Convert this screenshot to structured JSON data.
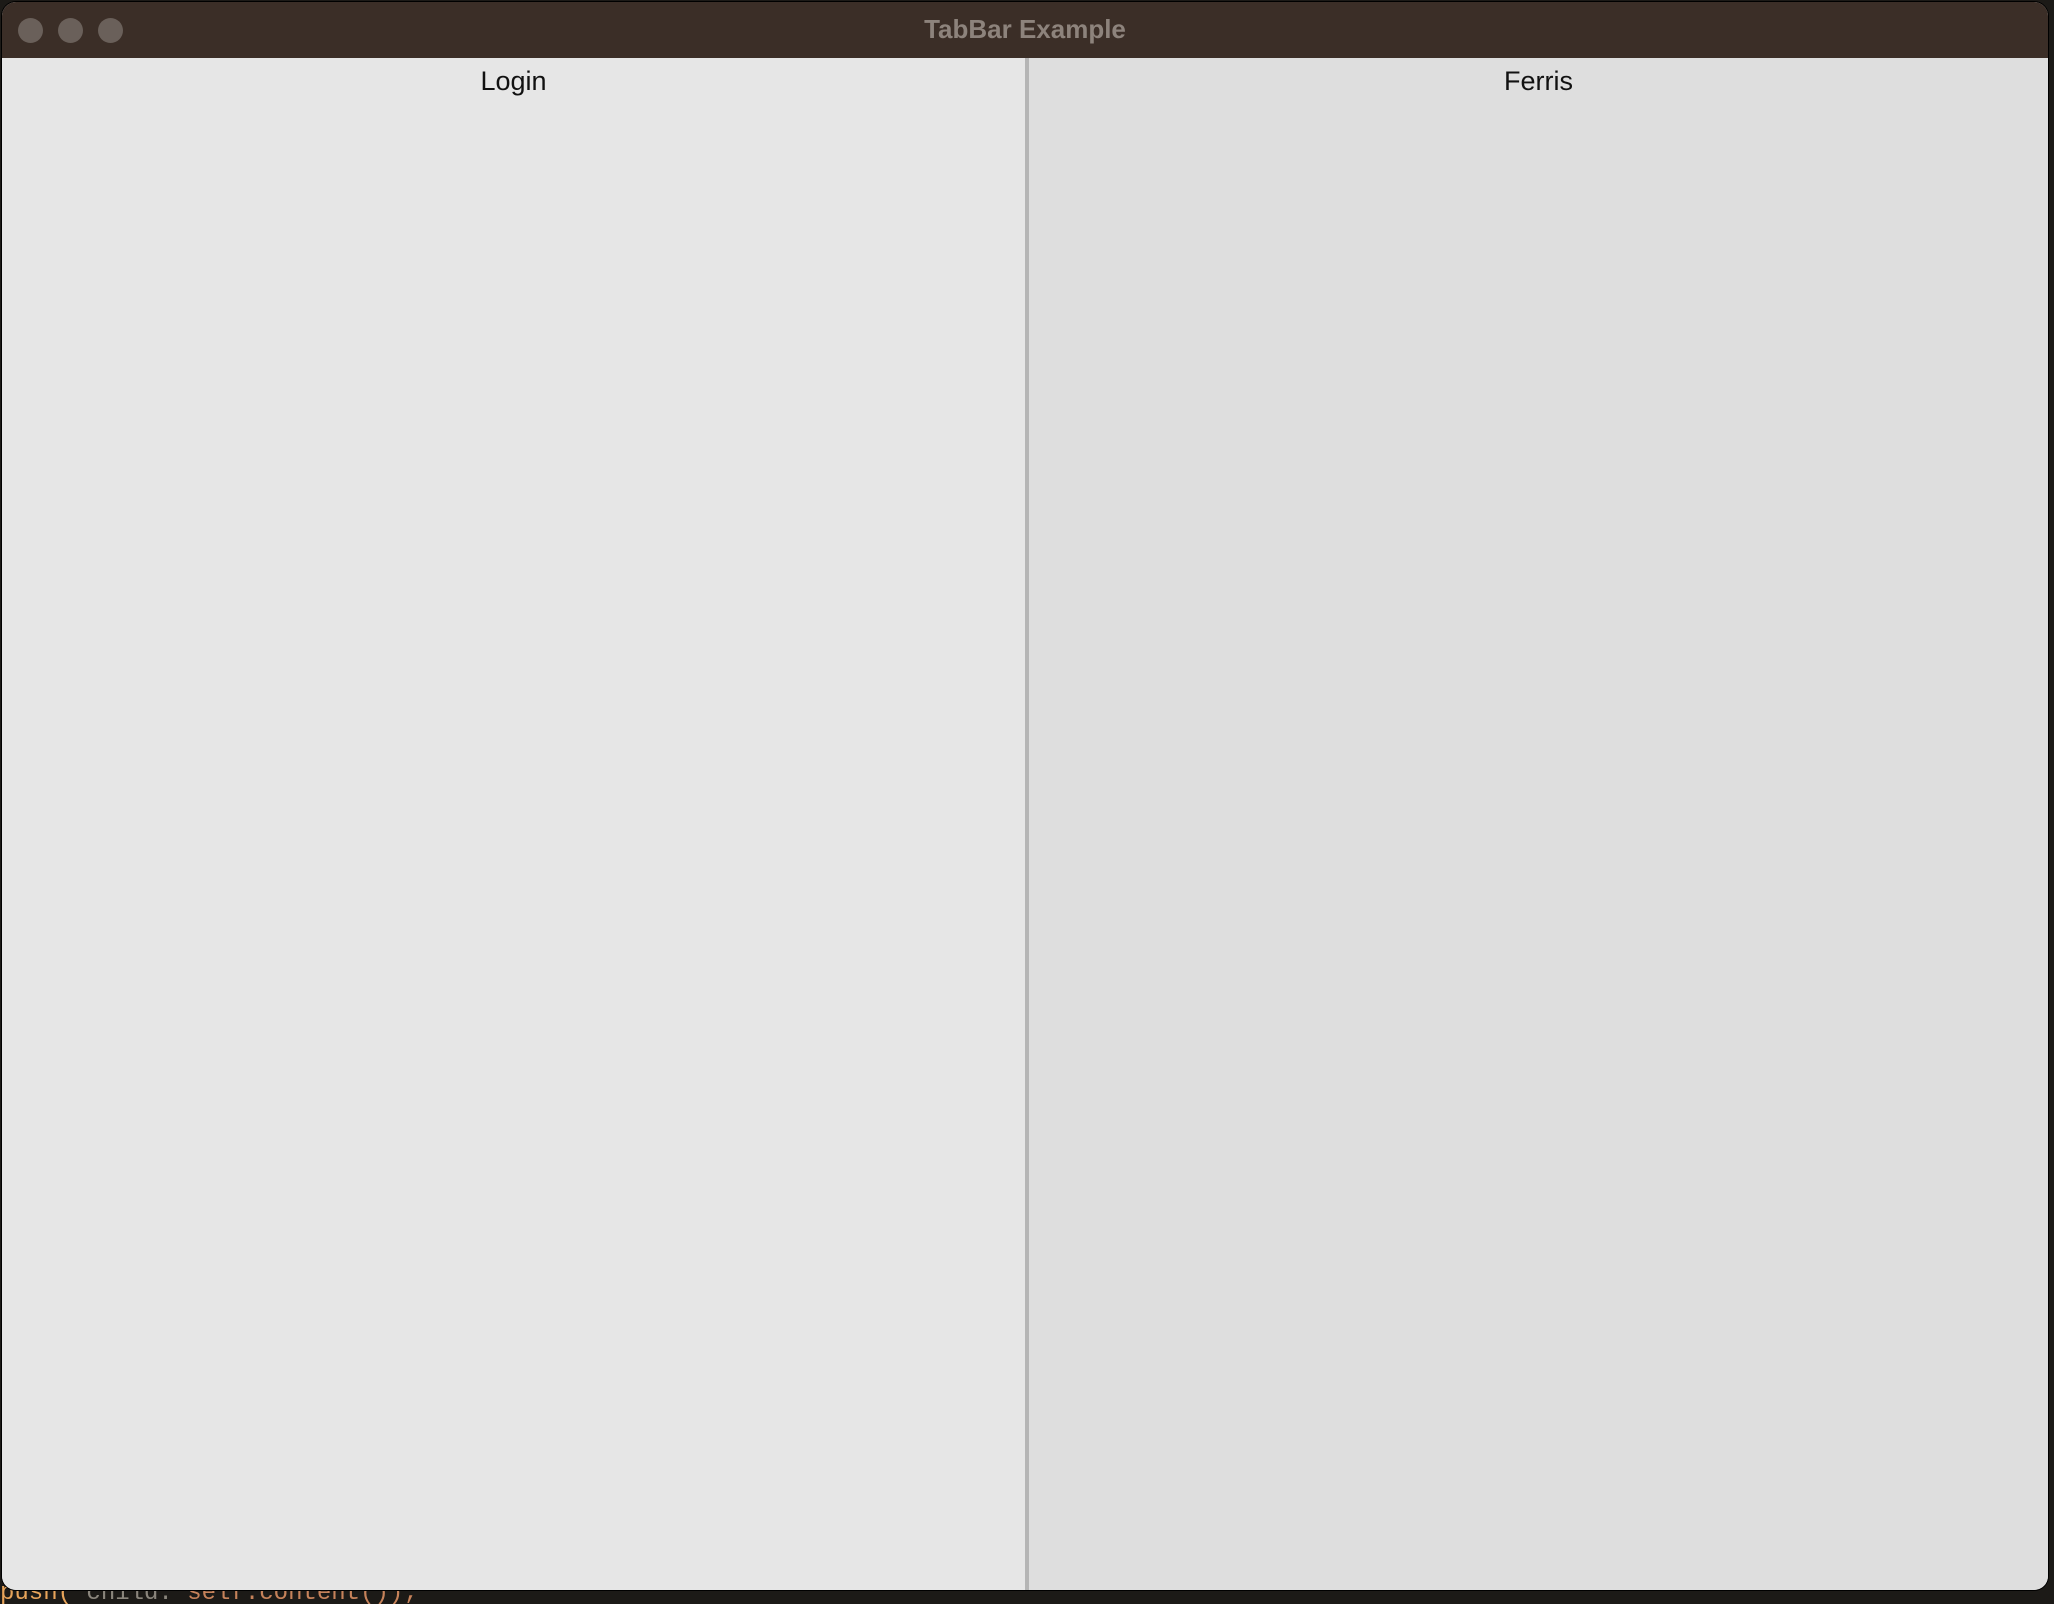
{
  "window": {
    "title": "TabBar Example"
  },
  "tabs": [
    {
      "label": "Login"
    },
    {
      "label": "Ferris"
    }
  ],
  "background_code": {
    "token_fn": "push(",
    "token_param": "child:",
    "token_self": "self.content());"
  },
  "colors": {
    "titlebar": "#3b2e27",
    "tab_active_bg": "#e6e6e6",
    "tab_inactive_bg": "#dedede",
    "divider": "#b5b5b5"
  }
}
